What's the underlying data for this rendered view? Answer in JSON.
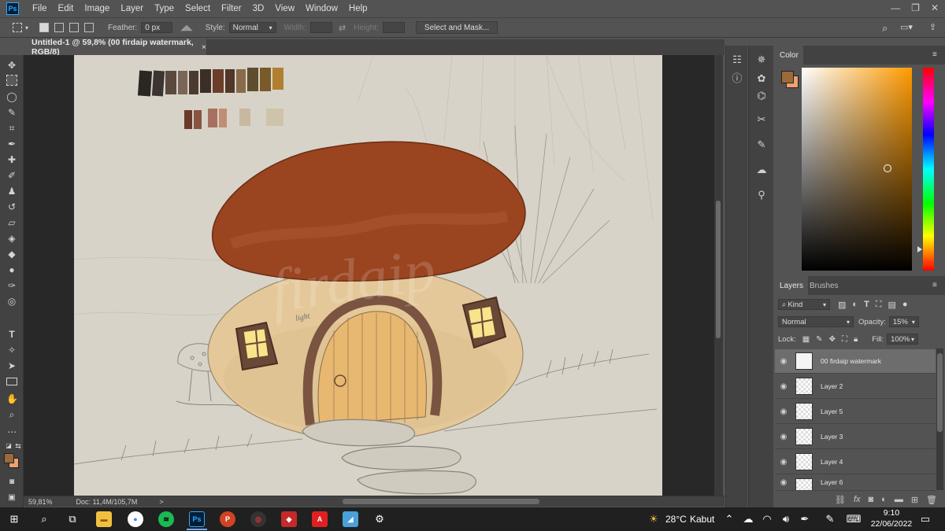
{
  "app": {
    "logo": "Ps",
    "menu": [
      "File",
      "Edit",
      "Image",
      "Layer",
      "Type",
      "Select",
      "Filter",
      "3D",
      "View",
      "Window",
      "Help"
    ]
  },
  "options_bar": {
    "feather_label": "Feather:",
    "feather_value": "0 px",
    "style_label": "Style:",
    "style_value": "Normal",
    "width_label": "Width:",
    "height_label": "Height:",
    "select_mask_label": "Select and Mask..."
  },
  "document": {
    "tab_title": "Untitled-1 @ 59,8% (00 firdaip watermark, RGB/8)",
    "close_glyph": "×",
    "watermark_text": "firdaip",
    "annotation": "light"
  },
  "status_bar": {
    "zoom": "59,81%",
    "doc_size": "Doc: 11,4M/105,7M",
    "arrow": ">"
  },
  "color_panel": {
    "tab": "Color",
    "foreground": "#9c6a3a",
    "background": "#f0a070",
    "hue": "#ff9a00"
  },
  "layers_panel": {
    "tab_layers": "Layers",
    "tab_brushes": "Brushes",
    "filter_kind": "Kind",
    "blend_mode": "Normal",
    "opacity_label": "Opacity:",
    "opacity_value": "15%",
    "lock_label": "Lock:",
    "fill_label": "Fill:",
    "fill_value": "100%",
    "layers": [
      {
        "name": "00 firdaip watermark",
        "selected": true
      },
      {
        "name": "Layer 2",
        "selected": false
      },
      {
        "name": "Layer 5",
        "selected": false
      },
      {
        "name": "Layer 3",
        "selected": false
      },
      {
        "name": "Layer 4",
        "selected": false
      },
      {
        "name": "Layer 6",
        "selected": false
      }
    ]
  },
  "taskbar": {
    "weather_temp": "28°C",
    "weather_desc": "Kabut",
    "time": "9:10",
    "date": "22/06/2022"
  }
}
